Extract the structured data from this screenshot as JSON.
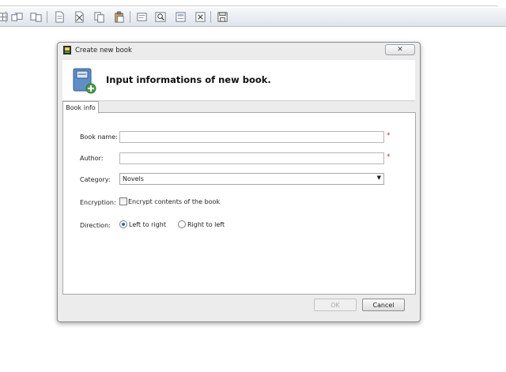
{
  "toolbar": {
    "buttons": [
      "grid-icon",
      "copy-icon",
      "copy-alt-icon",
      "paste-icon",
      "document-icon",
      "cut-icon",
      "copy-pages-icon",
      "clipboard-icon",
      "preview-icon",
      "zoom-icon",
      "properties-icon",
      "delete-icon",
      "save-icon"
    ]
  },
  "dialog": {
    "title": "Create new book",
    "close_label": "✕",
    "banner_text": "Input informations of new book.",
    "tab_label": "Book info",
    "fields": {
      "book_name_label": "Book name:",
      "book_name_value": "",
      "author_label": "Author:",
      "author_value": "",
      "required_mark": "*",
      "category_label": "Category:",
      "category_value": "Novels",
      "category_arrow": "▼",
      "encryption_label": "Encryption:",
      "encrypt_checkbox_label": "Encrypt contents of the book",
      "encrypt_checked": false,
      "direction_label": "Direction:",
      "direction_options": [
        "Left to right",
        "Right to left"
      ],
      "direction_selected": "Left to right"
    },
    "ok_label": "OK",
    "cancel_label": "Cancel"
  },
  "colors": {
    "required": "#d23030",
    "radio_selected": "#1d67c4",
    "toolbar_bg": "#dfe3ea"
  }
}
